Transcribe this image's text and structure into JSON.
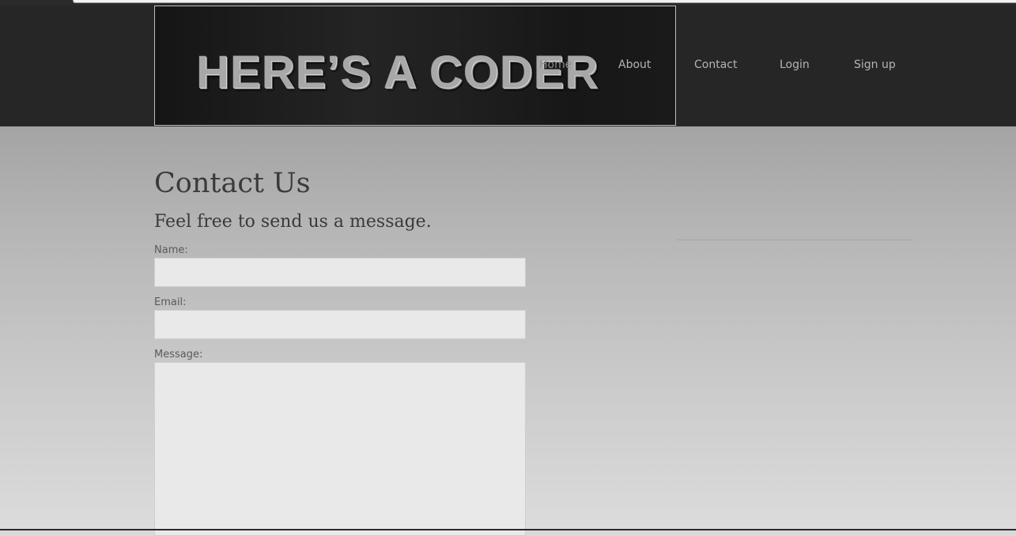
{
  "header": {
    "banner_title": "HERE’S A CODER"
  },
  "nav": {
    "items": [
      {
        "label": "Home"
      },
      {
        "label": "About"
      },
      {
        "label": "Contact"
      },
      {
        "label": "Login"
      },
      {
        "label": "Sign up"
      }
    ]
  },
  "main": {
    "title": "Contact Us",
    "subtitle": "Feel free to send us a message.",
    "form": {
      "name_label": "Name:",
      "name_value": "",
      "email_label": "Email:",
      "email_value": "",
      "message_label": "Message:",
      "message_value": ""
    }
  },
  "colors": {
    "header_background": "#262626",
    "nav_text": "#b4b4b4",
    "heading_text": "#3a3a3a",
    "input_background": "#e9e9e9"
  }
}
